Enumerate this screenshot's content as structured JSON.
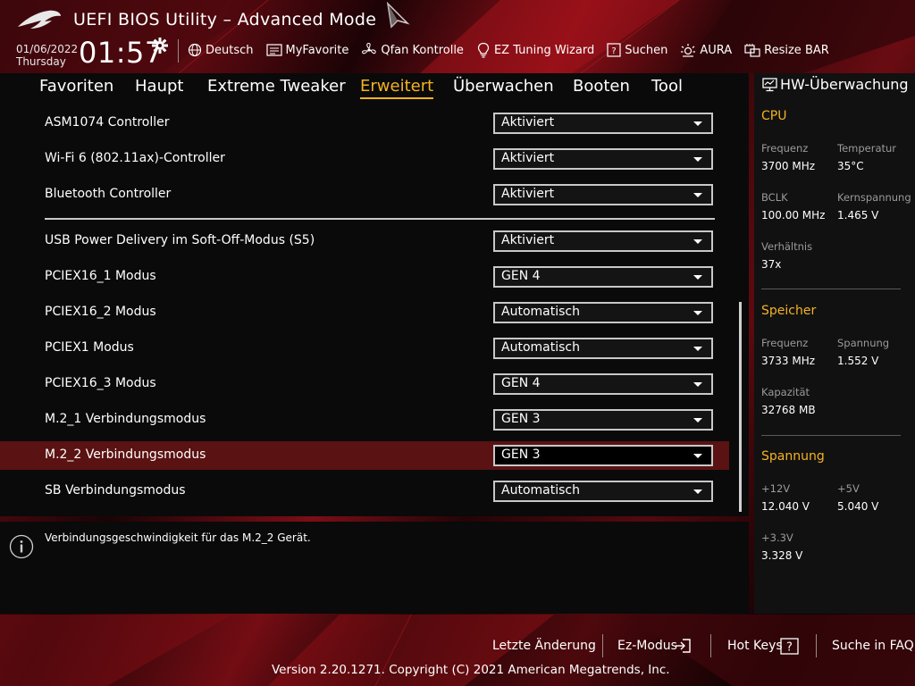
{
  "app": {
    "title": "UEFI BIOS Utility – Advanced Mode",
    "date": "01/06/2022",
    "weekday": "Thursday",
    "time": "01:57"
  },
  "toolbar": [
    {
      "id": "language",
      "label": "Deutsch",
      "icon": "globe-icon"
    },
    {
      "id": "myfavorite",
      "label": "MyFavorite",
      "icon": "myfavorite-icon"
    },
    {
      "id": "qfan",
      "label": "Qfan Kontrolle",
      "icon": "fan-icon"
    },
    {
      "id": "ez-tuning",
      "label": "EZ Tuning Wizard",
      "icon": "lightbulb-icon"
    },
    {
      "id": "search",
      "label": "Suchen",
      "icon": "search-help-icon"
    },
    {
      "id": "aura",
      "label": "AURA",
      "icon": "aura-icon"
    },
    {
      "id": "resize-bar",
      "label": "Resize BAR",
      "icon": "resize-bar-icon"
    }
  ],
  "tabs": [
    {
      "label": "Favoriten",
      "active": false
    },
    {
      "label": "Haupt",
      "active": false
    },
    {
      "label": "Extreme Tweaker",
      "active": false
    },
    {
      "label": "Erweitert",
      "active": true
    },
    {
      "label": "Überwachen",
      "active": false
    },
    {
      "label": "Booten",
      "active": false
    },
    {
      "label": "Tool",
      "active": false
    }
  ],
  "settings": [
    {
      "label": "ASM1074 Controller",
      "value": "Aktiviert"
    },
    {
      "label": "Wi-Fi 6 (802.11ax)-Controller",
      "value": "Aktiviert"
    },
    {
      "label": "Bluetooth Controller",
      "value": "Aktiviert"
    },
    {
      "label": "USB Power Delivery im Soft-Off-Modus (S5)",
      "value": "Aktiviert"
    },
    {
      "label": "PCIEX16_1 Modus",
      "value": "GEN 4"
    },
    {
      "label": "PCIEX16_2 Modus",
      "value": "Automatisch"
    },
    {
      "label": "PCIEX1 Modus",
      "value": "Automatisch"
    },
    {
      "label": "PCIEX16_3 Modus",
      "value": "GEN 4"
    },
    {
      "label": "M.2_1 Verbindungsmodus",
      "value": "GEN 3"
    },
    {
      "label": "M.2_2 Verbindungsmodus",
      "value": "GEN 3",
      "selected": true
    },
    {
      "label": "SB Verbindungsmodus",
      "value": "Automatisch"
    }
  ],
  "help": {
    "text": "Verbindungsgeschwindigkeit für das M.2_2 Gerät."
  },
  "hw_monitor": {
    "title": "HW-Überwachung",
    "cpu": {
      "title": "CPU",
      "freq_label": "Frequenz",
      "freq_value": "3700 MHz",
      "temp_label": "Temperatur",
      "temp_value": "35°C",
      "bclk_label": "BCLK",
      "bclk_value": "100.00 MHz",
      "vcore_label": "Kernspannung",
      "vcore_value": "1.465 V",
      "ratio_label": "Verhältnis",
      "ratio_value": "37x"
    },
    "memory": {
      "title": "Speicher",
      "freq_label": "Frequenz",
      "freq_value": "3733 MHz",
      "volt_label": "Spannung",
      "volt_value": "1.552 V",
      "cap_label": "Kapazität",
      "cap_value": "32768 MB"
    },
    "voltage": {
      "title": "Spannung",
      "v12_label": "+12V",
      "v12_value": "12.040 V",
      "v5_label": "+5V",
      "v5_value": "5.040 V",
      "v33_label": "+3.3V",
      "v33_value": "3.328 V"
    }
  },
  "footer": {
    "last_change": "Letzte Änderung",
    "ez_mode": "Ez-Modus",
    "hot_keys": "Hot Keys",
    "faq": "Suche in FAQ",
    "copyright": "Version 2.20.1271. Copyright (C) 2021 American Megatrends, Inc."
  },
  "colors": {
    "accent": "#f5b323",
    "selected_row": "#5a1212",
    "panel_bg": "#0a0a0a"
  }
}
